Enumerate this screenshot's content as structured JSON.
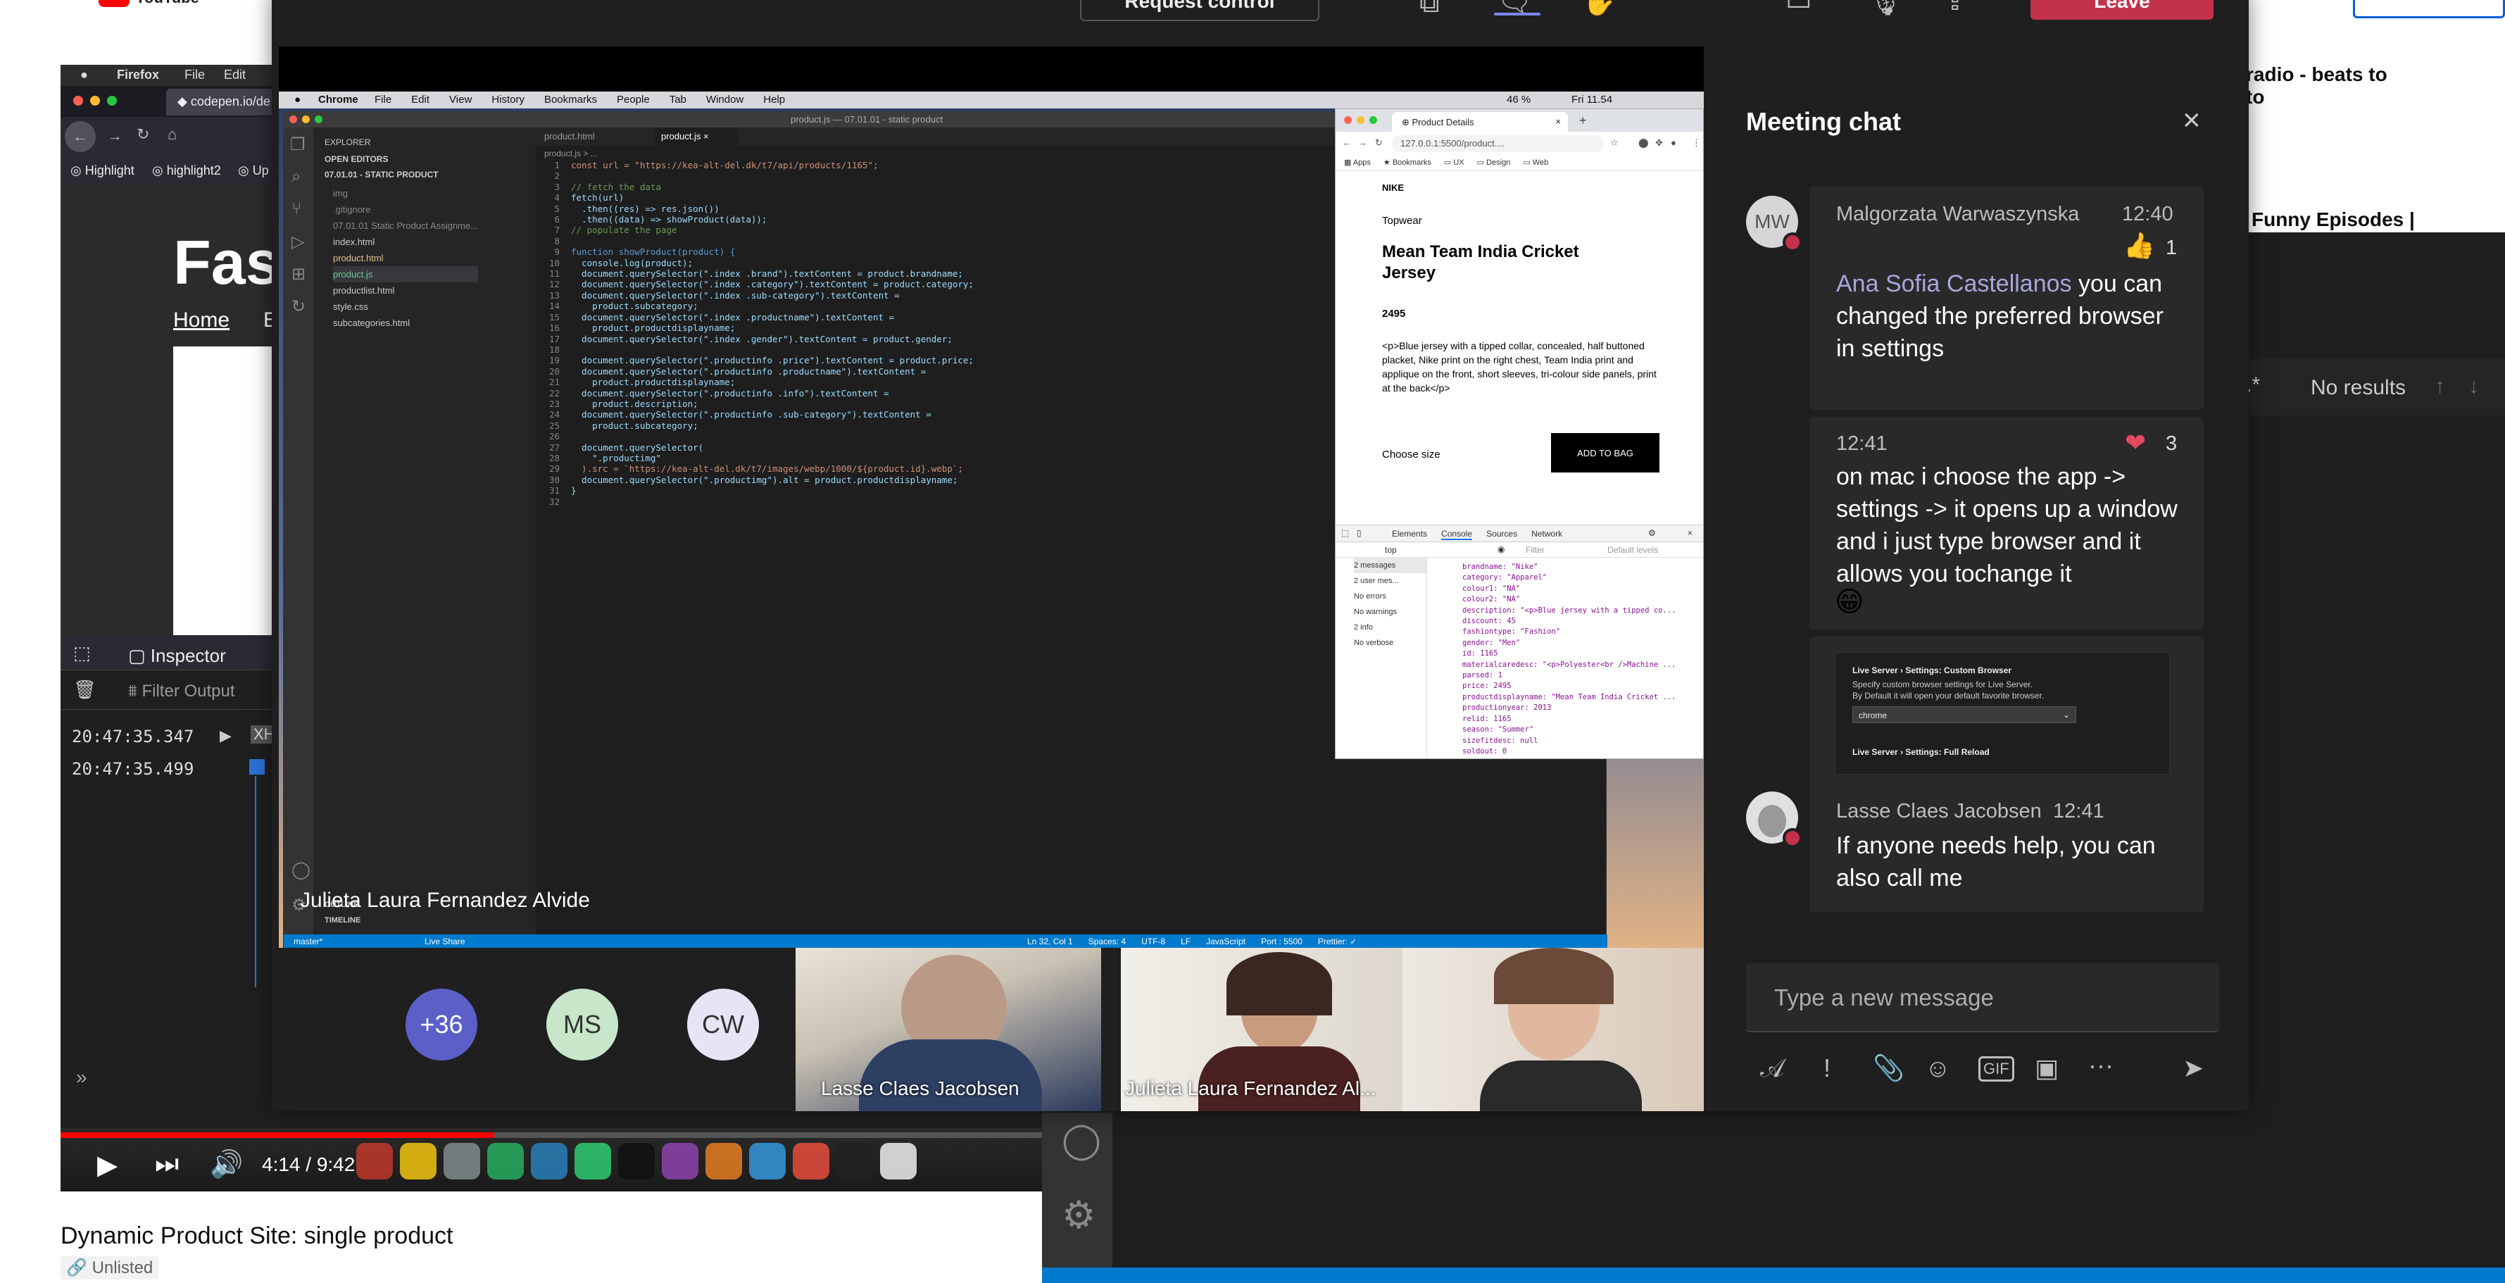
{
  "youtube": {
    "logo_text": "YouTube",
    "video_title": "Dynamic Product Site: single product",
    "visibility": "Unlisted",
    "time": "4:14 / 9:42",
    "progress": 0.44,
    "related_1_line1": "radio - beats to",
    "related_1_line2": "to",
    "related_2": "Funny Episodes |",
    "account_icon": "avatar-icon"
  },
  "firefox_share": {
    "menubar": [
      "Firefox",
      "File",
      "Edit"
    ],
    "tab_title": "codepen.io/de",
    "bookmarks": [
      "Highlight",
      "highlight2",
      "Up"
    ],
    "page_heading": "Fas",
    "breadcrumb_home": "Home",
    "breadcrumb_next": "E",
    "devtools_inspector": "Inspector",
    "filter_placeholder": "Filter Output",
    "log_times": [
      "20:47:35.347",
      "20:47:35.499"
    ],
    "log_tag": "XH"
  },
  "vscode_bg": {
    "search_result": "No results"
  },
  "teams": {
    "top_button": "Request control",
    "leave_label": "Leave",
    "presenter_name": "Julieta Laura Fernandez Alvide",
    "participants": [
      {
        "initials": "+36"
      },
      {
        "initials": "MS"
      },
      {
        "initials": "CW"
      }
    ],
    "video_tiles": [
      {
        "name": "Lasse Claes Jacobsen"
      },
      {
        "name": "Julieta Laura Fernandez Al..."
      },
      {
        "name": ""
      }
    ],
    "chat": {
      "title": "Meeting chat",
      "msg1": {
        "initials": "MW",
        "sender": "Malgorzata Warwaszynska",
        "time": "12:40",
        "reaction_count": "1",
        "mention": "Ana Sofia Castellanos",
        "text": " you can changed the preferred browser in settings"
      },
      "msg2": {
        "time": "12:41",
        "reaction_count": "3",
        "text": "on mac i choose the app -> settings -> it opens up a window and i just type browser and it allows you tochange it",
        "emoji": "😁"
      },
      "msg3": {
        "title1": "Live Server › Settings: Custom Browser",
        "desc1": "Specify custom browser settings for Live Server.",
        "desc2": "By Default it will open your default favorite browser.",
        "select_value": "chrome",
        "title2": "Live Server › Settings: Full Reload"
      },
      "msg4": {
        "sender": "Lasse Claes Jacobsen",
        "time": "12:41",
        "text": "If anyone needs help, you can also call me"
      },
      "compose_placeholder": "Type a new message"
    }
  },
  "mac_shared": {
    "app": "Chrome",
    "menus": [
      "File",
      "Edit",
      "View",
      "History",
      "Bookmarks",
      "People",
      "Tab",
      "Window",
      "Help"
    ],
    "status_right": "46 %",
    "clock": "Fri 11.54"
  },
  "vscode": {
    "title": "product.js — 07.01.01 - static product",
    "explorer_title": "EXPLORER",
    "open_editors": "OPEN EDITORS",
    "project": "07.01.01 - STATIC PRODUCT",
    "files": [
      "img",
      ".gitignore",
      "07.01.01 Static Product Assignme...",
      "index.html",
      "product.html",
      "product.js",
      "productlist.html",
      "style.css",
      "subcategories.html"
    ],
    "tabs": [
      "product.html",
      "product.js"
    ],
    "breadcrumb": "product.js > ...",
    "outline": "OUTLINE",
    "timeline": "TIMELINE",
    "code": [
      "const url = \"https://kea-alt-del.dk/t7/api/products/1165\";",
      "",
      "// fetch the data",
      "fetch(url)",
      "  .then((res) => res.json())",
      "  .then((data) => showProduct(data));",
      "// populate the page",
      "",
      "function showProduct(product) {",
      "  console.log(product);",
      "  document.querySelector(\".index .brand\").textContent = product.brandname;",
      "  document.querySelector(\".index .category\").textContent = product.category;",
      "  document.querySelector(\".index .sub-category\").textContent =",
      "    product.subcategory;",
      "  document.querySelector(\".index .productname\").textContent =",
      "    product.productdisplayname;",
      "  document.querySelector(\".index .gender\").textContent = product.gender;",
      "",
      "  document.querySelector(\".productinfo .price\").textContent = product.price;",
      "  document.querySelector(\".productinfo .productname\").textContent =",
      "    product.productdisplayname;",
      "  document.querySelector(\".productinfo .info\").textContent =",
      "    product.description;",
      "  document.querySelector(\".productinfo .sub-category\").textContent =",
      "    product.subcategory;",
      "",
      "  document.querySelector(",
      "    \".productimg\"",
      "  ).src = `https://kea-alt-del.dk/t7/images/webp/1000/${product.id}.webp`;",
      "  document.querySelector(\".productimg\").alt = product.productdisplayname;",
      "}",
      ""
    ],
    "status_left": "master*",
    "status_live": "Live Share",
    "status_right": [
      "Ln 32, Col 1",
      "Spaces: 4",
      "UTF-8",
      "LF",
      "JavaScript",
      "Port : 5500",
      "Prettier: ✓"
    ]
  },
  "chrome": {
    "tab_title": "Product Details",
    "url": "127.0.0.1:5500/product....",
    "bookmarks": [
      "Apps",
      "Bookmarks",
      "UX",
      "Design",
      "Web"
    ],
    "brand": "NIKE",
    "category": "Topwear",
    "product_name": "Mean Team India Cricket Jersey",
    "price": "2495",
    "description": "<p>Blue jersey with a tipped collar, concealed, half buttoned placket, Nike print on the right chest, Team India print and applique on the front, short sleeves, tri-colour side panels, print at the back</p>",
    "choose_size": "Choose size",
    "add_to_bag": "ADD TO BAG",
    "devtools_tabs": [
      "Elements",
      "Console",
      "Sources",
      "Network"
    ],
    "context": "top",
    "filter": "Filter",
    "levels": "Default levels",
    "sidebar": [
      "2 messages",
      "2 user mes...",
      "No errors",
      "No warnings",
      "2 info",
      "No verbose"
    ],
    "console_lines": [
      "brandname: \"Nike\"",
      "category: \"Apparel\"",
      "colour1: \"NA\"",
      "colour2: \"NA\"",
      "description: \"<p>Blue jersey with a tipped co...",
      "discount: 45",
      "fashiontype: \"Fashion\"",
      "gender: \"Men\"",
      "id: 1165",
      "materialcaredesc: \"<p>Polyester<br />Machine ...",
      "parsed: 1",
      "price: 2495",
      "productdisplayname: \"Mean Team India Cricket ...",
      "productionyear: 2013",
      "relid: 1165",
      "season: \"Summer\"",
      "sizefitdesc: null",
      "soldout: 0"
    ]
  },
  "colors": {
    "teams_bg": "#1f1f1f",
    "chat_bubble": "#292929",
    "mention": "#a6a7dc",
    "leave": "#c4314b",
    "presence_busy": "#c4314b",
    "vscode_status": "#007acc",
    "youtube_red": "#ff0000"
  }
}
